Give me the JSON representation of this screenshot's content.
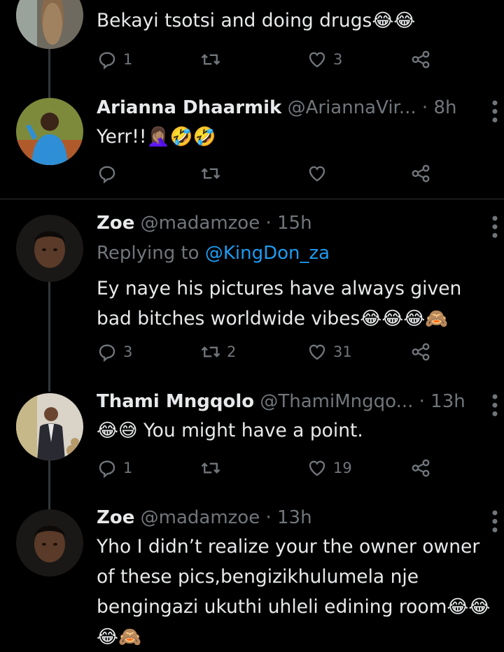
{
  "tweets": [
    {
      "text": "Bekayi tsotsi and doing drugs😂😂",
      "replies": "1",
      "retweets": "",
      "likes": "3"
    },
    {
      "name": "Arianna Dhaarmik",
      "handle": "@AriannaVir...",
      "time": "· 8h",
      "text": "Yerr!!🤦🏽‍♀️🤣🤣",
      "replies": "",
      "retweets": "",
      "likes": ""
    },
    {
      "name": "Zoe",
      "handle": "@madamzoe",
      "time": "· 15h",
      "replying_prefix": "Replying to",
      "replying_handle": "@KingDon_za",
      "text": "Ey naye his pictures have always given bad bitches worldwide vibes😂😂😂🙈",
      "replies": "3",
      "retweets": "2",
      "likes": "31"
    },
    {
      "name": "Thami Mngqolo",
      "handle": "@ThamiMngqo...",
      "time": "· 13h",
      "text": "😂😅 You might have a point.",
      "replies": "1",
      "retweets": "",
      "likes": "19"
    },
    {
      "name": "Zoe",
      "handle": "@madamzoe",
      "time": "· 13h",
      "text": "Yho I didn’t realize your the owner owner of these pics,bengizikhulumela nje bengingazi ukuthi uhleli edining room😂😂😂🙈",
      "replies": "",
      "retweets": "",
      "likes": ""
    }
  ],
  "icons": {
    "reply": "reply-icon",
    "retweet": "retweet-icon",
    "like": "heart-icon",
    "share": "share-icon",
    "more": "more-icon"
  },
  "colors": {
    "background": "#000000",
    "text": "#e7e9ea",
    "muted": "#71767b",
    "link": "#1d9bf0",
    "divider": "#2f3336"
  }
}
